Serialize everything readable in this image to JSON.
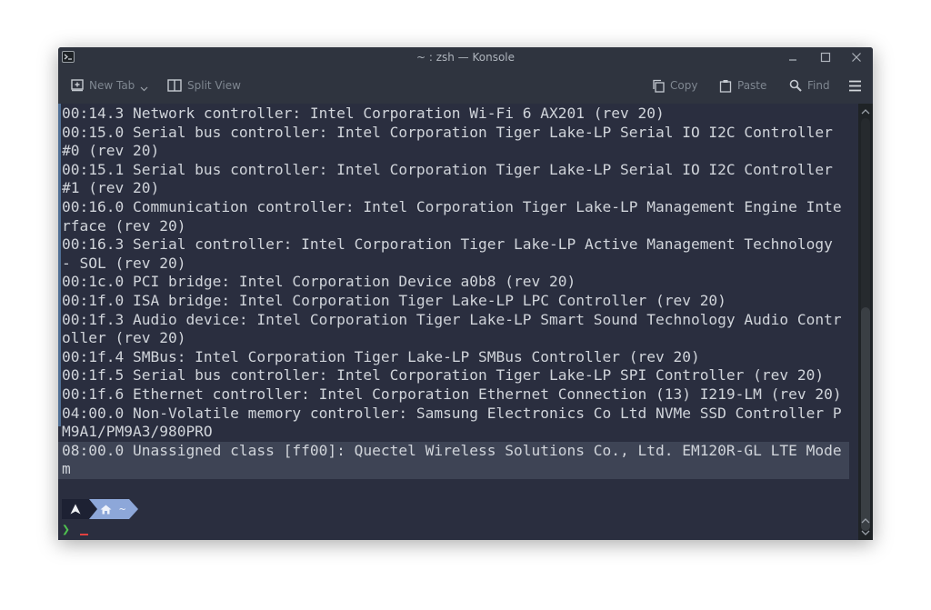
{
  "window": {
    "title": "~ : zsh — Konsole"
  },
  "toolbar": {
    "new_tab_label": "New Tab",
    "split_view_label": "Split View",
    "copy_label": "Copy",
    "paste_label": "Paste",
    "find_label": "Find"
  },
  "terminal": {
    "lines": [
      "00:14.3 Network controller: Intel Corporation Wi-Fi 6 AX201 (rev 20)",
      "00:15.0 Serial bus controller: Intel Corporation Tiger Lake-LP Serial IO I2C Controller",
      "#0 (rev 20)",
      "00:15.1 Serial bus controller: Intel Corporation Tiger Lake-LP Serial IO I2C Controller",
      "#1 (rev 20)",
      "00:16.0 Communication controller: Intel Corporation Tiger Lake-LP Management Engine Inte",
      "rface (rev 20)",
      "00:16.3 Serial controller: Intel Corporation Tiger Lake-LP Active Management Technology",
      "- SOL (rev 20)",
      "00:1c.0 PCI bridge: Intel Corporation Device a0b8 (rev 20)",
      "00:1f.0 ISA bridge: Intel Corporation Tiger Lake-LP LPC Controller (rev 20)",
      "00:1f.3 Audio device: Intel Corporation Tiger Lake-LP Smart Sound Technology Audio Contr",
      "oller (rev 20)",
      "00:1f.4 SMBus: Intel Corporation Tiger Lake-LP SMBus Controller (rev 20)",
      "00:1f.5 Serial bus controller: Intel Corporation Tiger Lake-LP SPI Controller (rev 20)",
      "00:1f.6 Ethernet controller: Intel Corporation Ethernet Connection (13) I219-LM (rev 20)",
      "04:00.0 Non-Volatile memory controller: Samsung Electronics Co Ltd NVMe SSD Controller P",
      "M9A1/PM9A3/980PRO",
      "08:00.0 Unassigned class [ff00]: Quectel Wireless Solutions Co., Ltd. EM120R-GL LTE Mode",
      "m"
    ],
    "highlighted_from": 18
  },
  "prompt": {
    "path_label": "~",
    "caret": "❯"
  },
  "colors": {
    "terminal_bg": "#2a2e3f",
    "text": "#d0d4da",
    "highlight_bg": "#3e4455",
    "prompt_home_bg": "#8da7d9",
    "prompt_caret": "#4fc14f",
    "cursor": "#e04040"
  }
}
